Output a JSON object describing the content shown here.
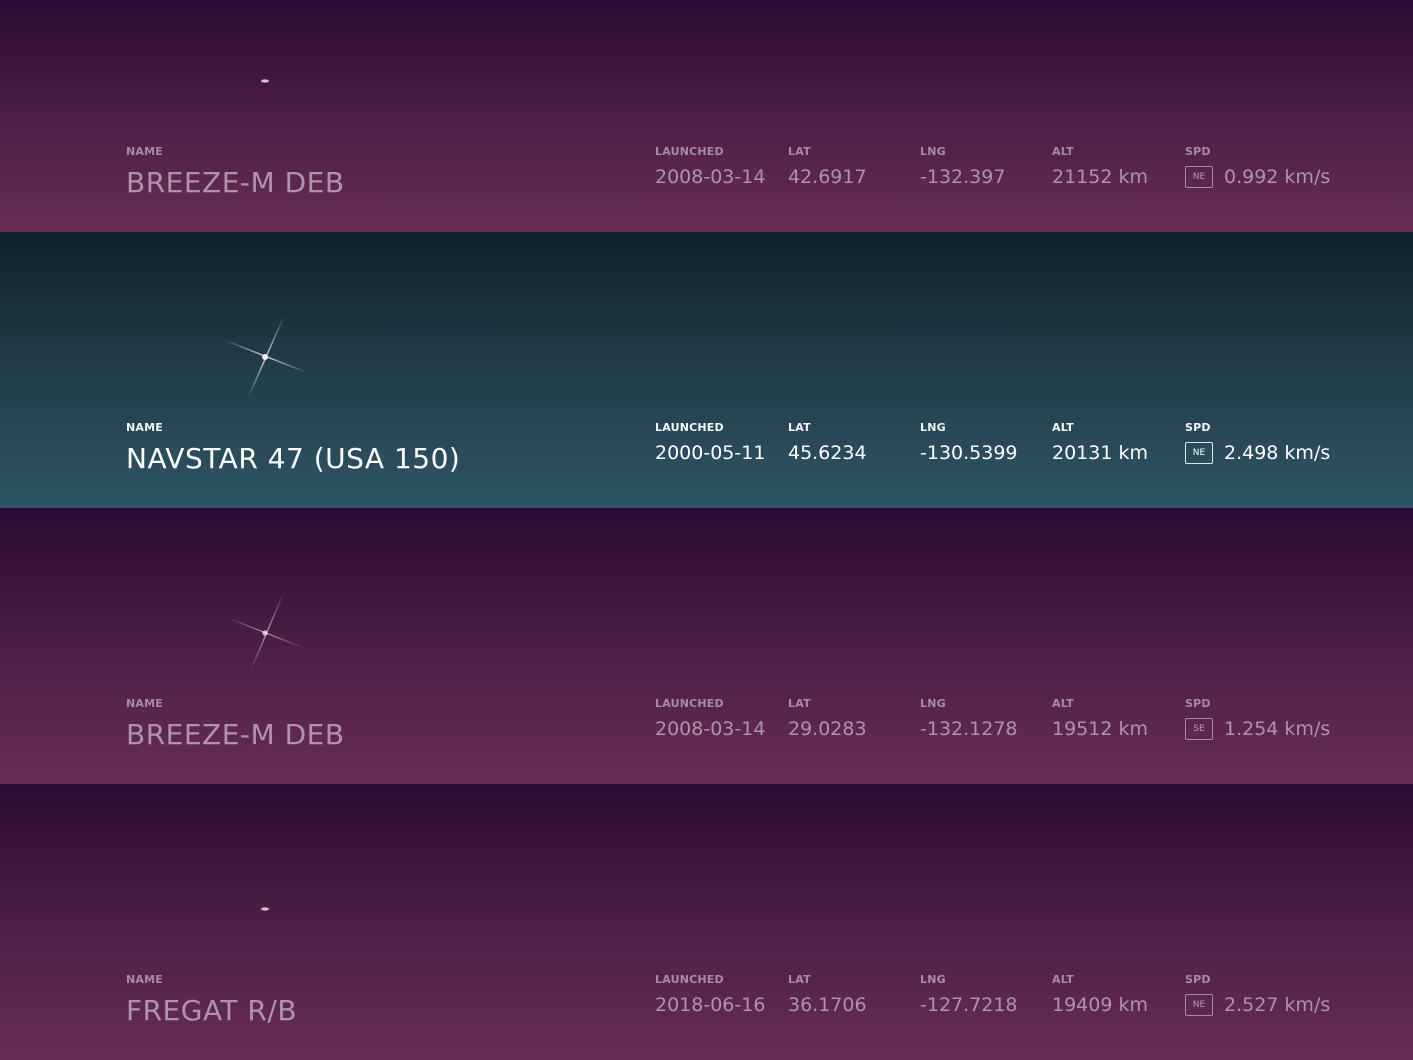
{
  "labels": {
    "name": "NAME",
    "launched": "LAUNCHED",
    "lat": "LAT",
    "lng": "LNG",
    "alt": "ALT",
    "spd": "SPD"
  },
  "satellites": [
    {
      "name": "BREEZE-M DEB",
      "launched": "2008-03-14",
      "lat": "42.6917",
      "lng": "-132.397",
      "alt": "21152 km",
      "direction": "NE",
      "speed": "0.992 km/s",
      "icon": "satellite-trail-icon",
      "active": false
    },
    {
      "name": "NAVSTAR 47 (USA 150)",
      "launched": "2000-05-11",
      "lat": "45.6234",
      "lng": "-130.5399",
      "alt": "20131 km",
      "direction": "NE",
      "speed": "2.498 km/s",
      "icon": "satellite-flare-icon",
      "active": true
    },
    {
      "name": "BREEZE-M DEB",
      "launched": "2008-03-14",
      "lat": "29.0283",
      "lng": "-132.1278",
      "alt": "19512 km",
      "direction": "SE",
      "speed": "1.254 km/s",
      "icon": "satellite-flare-icon",
      "active": false
    },
    {
      "name": "FREGAT R/B",
      "launched": "2018-06-16",
      "lat": "36.1706",
      "lng": "-127.7218",
      "alt": "19409 km",
      "direction": "NE",
      "speed": "2.527 km/s",
      "icon": "satellite-trail-icon",
      "active": false
    }
  ],
  "colors": {
    "purple_top": "#2b0c34",
    "purple_bottom": "#682d55",
    "teal_top": "#11222a",
    "teal_bottom": "#2e5566"
  }
}
